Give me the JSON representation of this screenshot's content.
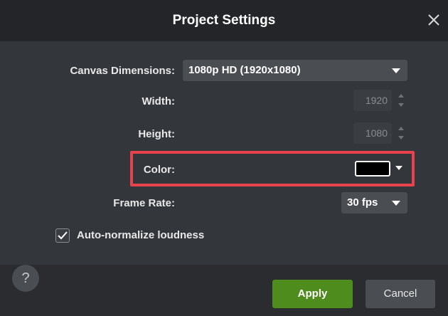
{
  "dialog": {
    "title": "Project Settings",
    "close_icon": "close-icon"
  },
  "canvas_dimensions": {
    "label": "Canvas Dimensions:",
    "value": "1080p HD (1920x1080)"
  },
  "width": {
    "label": "Width:",
    "value": "1920"
  },
  "height": {
    "label": "Height:",
    "value": "1080"
  },
  "color": {
    "label": "Color:",
    "value": "#000000"
  },
  "frame_rate": {
    "label": "Frame Rate:",
    "value": "30 fps"
  },
  "auto_normalize": {
    "label": "Auto-normalize loudness",
    "checked": true
  },
  "footer": {
    "help_label": "?",
    "apply_label": "Apply",
    "cancel_label": "Cancel"
  },
  "colors": {
    "accent_apply": "#4e8c1e",
    "highlight": "#e8424d",
    "background": "#33363b",
    "titlebar": "#232529"
  }
}
